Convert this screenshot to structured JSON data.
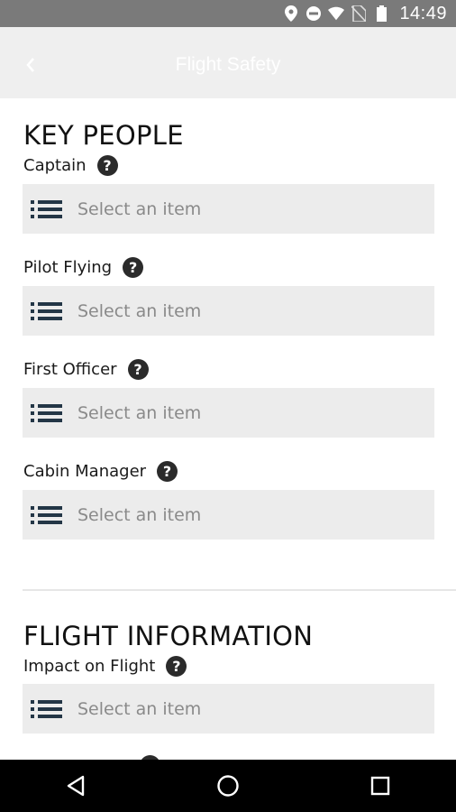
{
  "status_bar": {
    "time": "14:49",
    "icons": [
      "location-icon",
      "do-not-disturb-icon",
      "wifi-icon",
      "no-sim-icon",
      "battery-icon"
    ]
  },
  "header": {
    "title": "Flight Safety",
    "back_icon": "chevron-left-icon"
  },
  "sections": [
    {
      "title": "KEY PEOPLE",
      "fields": [
        {
          "label": "Captain",
          "placeholder": "Select an item"
        },
        {
          "label": "Pilot Flying",
          "placeholder": "Select an item"
        },
        {
          "label": "First Officer",
          "placeholder": "Select an item"
        },
        {
          "label": "Cabin Manager",
          "placeholder": "Select an item"
        }
      ]
    },
    {
      "title": "FLIGHT INFORMATION",
      "fields": [
        {
          "label": "Impact on Flight",
          "placeholder": "Select an item"
        }
      ]
    }
  ],
  "help_glyph": "?",
  "nav_bar": {
    "buttons": [
      "back-triangle-icon",
      "home-circle-icon",
      "recents-square-icon"
    ]
  },
  "colors": {
    "status_bar": "#7a7a7a",
    "header_bg": "#efefef",
    "select_bg": "#ececec",
    "list_icon": "#233646",
    "help_icon_bg": "#2b2b2b"
  }
}
